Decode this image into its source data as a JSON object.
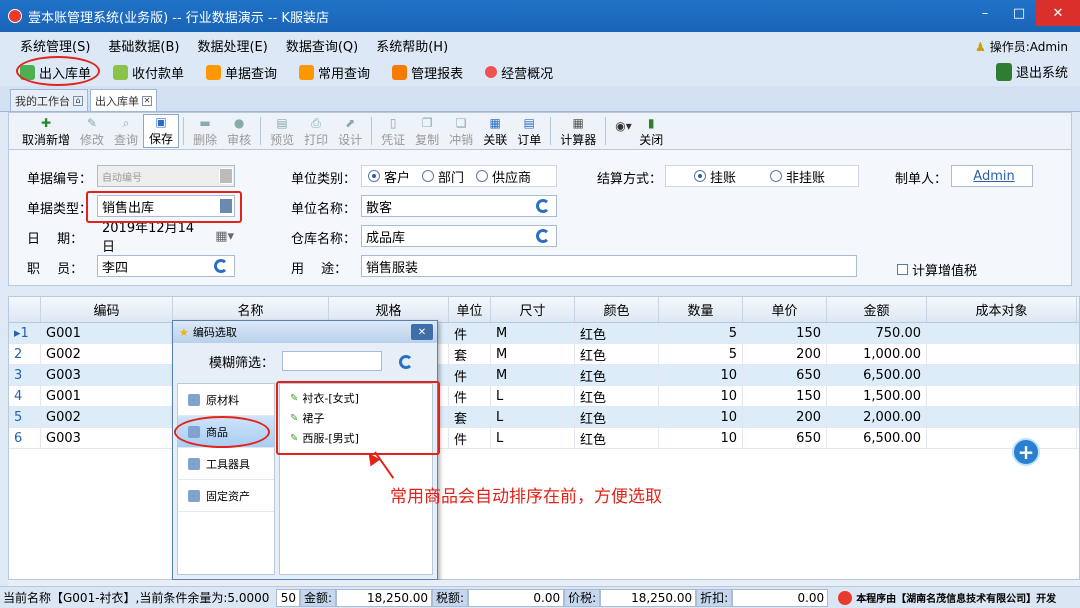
{
  "window": {
    "title": "壹本账管理系统(业务版) -- 行业数据演示 -- K服装店"
  },
  "menu": [
    "系统管理(S)",
    "基础数据(B)",
    "数据处理(E)",
    "数据查询(Q)",
    "系统帮助(H)"
  ],
  "operator": "操作员:Admin",
  "quickbar": [
    "出入库单",
    "收付款单",
    "单据查询",
    "常用查询",
    "管理报表",
    "经营概况"
  ],
  "exit_label": "退出系统",
  "tabs": [
    "我的工作台",
    "出入库单"
  ],
  "toolbar": [
    "取消新增",
    "修改",
    "查询",
    "保存",
    "删除",
    "审核",
    "预览",
    "打印",
    "设计",
    "凭证",
    "复制",
    "冲销",
    "关联",
    "订单",
    "计算器",
    "关闭"
  ],
  "form": {
    "doc_no_label": "单据编号：",
    "doc_no_value": "自动编号",
    "doc_type_label": "单据类型：",
    "doc_type_value": "销售出库",
    "date_label": "日　 期：",
    "date_value": "2019年12月14日",
    "staff_label": "职　 员：",
    "staff_value": "李四",
    "unit_type_label": "单位类别：",
    "unit_type_options": [
      "客户",
      "部门",
      "供应商"
    ],
    "unit_name_label": "单位名称：",
    "unit_name_value": "散客",
    "warehouse_label": "仓库名称：",
    "warehouse_value": "成品库",
    "purpose_label": "用　 途：",
    "purpose_value": "销售服装",
    "settle_label": "结算方式：",
    "settle_options": [
      "挂账",
      "非挂账"
    ],
    "maker_label": "制单人：",
    "maker_value": "Admin",
    "vat_label": "计算增值税"
  },
  "grid": {
    "headers": [
      "编码",
      "名称",
      "规格",
      "单位",
      "尺寸",
      "颜色",
      "数量",
      "单价",
      "金额",
      "成本对象"
    ],
    "rows": [
      {
        "idx": "1",
        "code": "G001",
        "unit": "件",
        "size": "M",
        "color": "红色",
        "qty": "5",
        "price": "150",
        "amount": "750.00"
      },
      {
        "idx": "2",
        "code": "G002",
        "unit": "套",
        "size": "M",
        "color": "红色",
        "qty": "5",
        "price": "200",
        "amount": "1,000.00"
      },
      {
        "idx": "3",
        "code": "G003",
        "unit": "件",
        "size": "M",
        "color": "红色",
        "qty": "10",
        "price": "650",
        "amount": "6,500.00"
      },
      {
        "idx": "4",
        "code": "G001",
        "unit": "件",
        "size": "L",
        "color": "红色",
        "qty": "10",
        "price": "150",
        "amount": "1,500.00"
      },
      {
        "idx": "5",
        "code": "G002",
        "unit": "套",
        "size": "L",
        "color": "红色",
        "qty": "10",
        "price": "200",
        "amount": "2,000.00"
      },
      {
        "idx": "6",
        "code": "G003",
        "unit": "件",
        "size": "L",
        "color": "红色",
        "qty": "10",
        "price": "650",
        "amount": "6,500.00"
      }
    ]
  },
  "popup": {
    "title": "编码选取",
    "filter_label": "模糊筛选：",
    "categories": [
      "原材料",
      "商品",
      "工具器具",
      "固定资产"
    ],
    "items": [
      "衬衣-[女式]",
      "裙子",
      "西服-[男式]"
    ]
  },
  "annotation": "常用商品会自动排序在前，方便选取",
  "status": {
    "current": "当前名称【G001-衬衣】,当前条件余量为:5.0000",
    "count": "50",
    "amount_label": "金额:",
    "amount": "18,250.00",
    "tax_label": "税额:",
    "tax": "0.00",
    "price_tax_label": "价税:",
    "price_tax": "18,250.00",
    "discount_label": "折扣:",
    "discount": "0.00",
    "company": "本程序由【湖南名茂信息技术有限公司】开发"
  }
}
